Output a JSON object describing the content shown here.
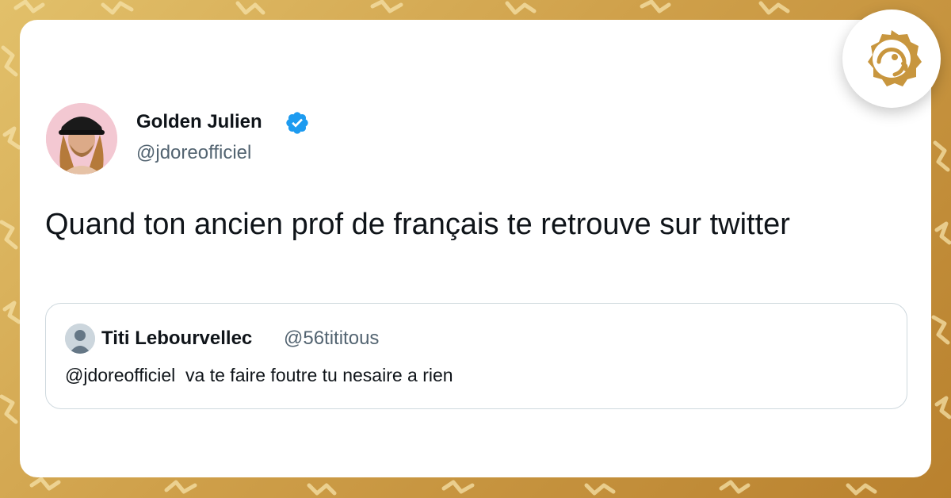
{
  "colors": {
    "background_gold": "#d4a852",
    "card": "#ffffff",
    "verified_blue": "#1d9bf0",
    "text_primary": "#0f1419",
    "text_secondary": "#536471",
    "logo_gold": "#c8963e"
  },
  "tweet": {
    "author_name": "Golden Julien",
    "author_handle": "@jdoreofficiel",
    "verified_icon": "verified-badge-icon",
    "text": "Quand ton ancien prof de français te retrouve sur twitter"
  },
  "quoted_tweet": {
    "author_name": "Titi Lebourvellec",
    "author_handle": "@56tititous",
    "text": "@jdoreofficiel  va te faire foutre tu nesaire a rien"
  },
  "brand": {
    "logo_icon": "face-seal-logo-icon"
  }
}
